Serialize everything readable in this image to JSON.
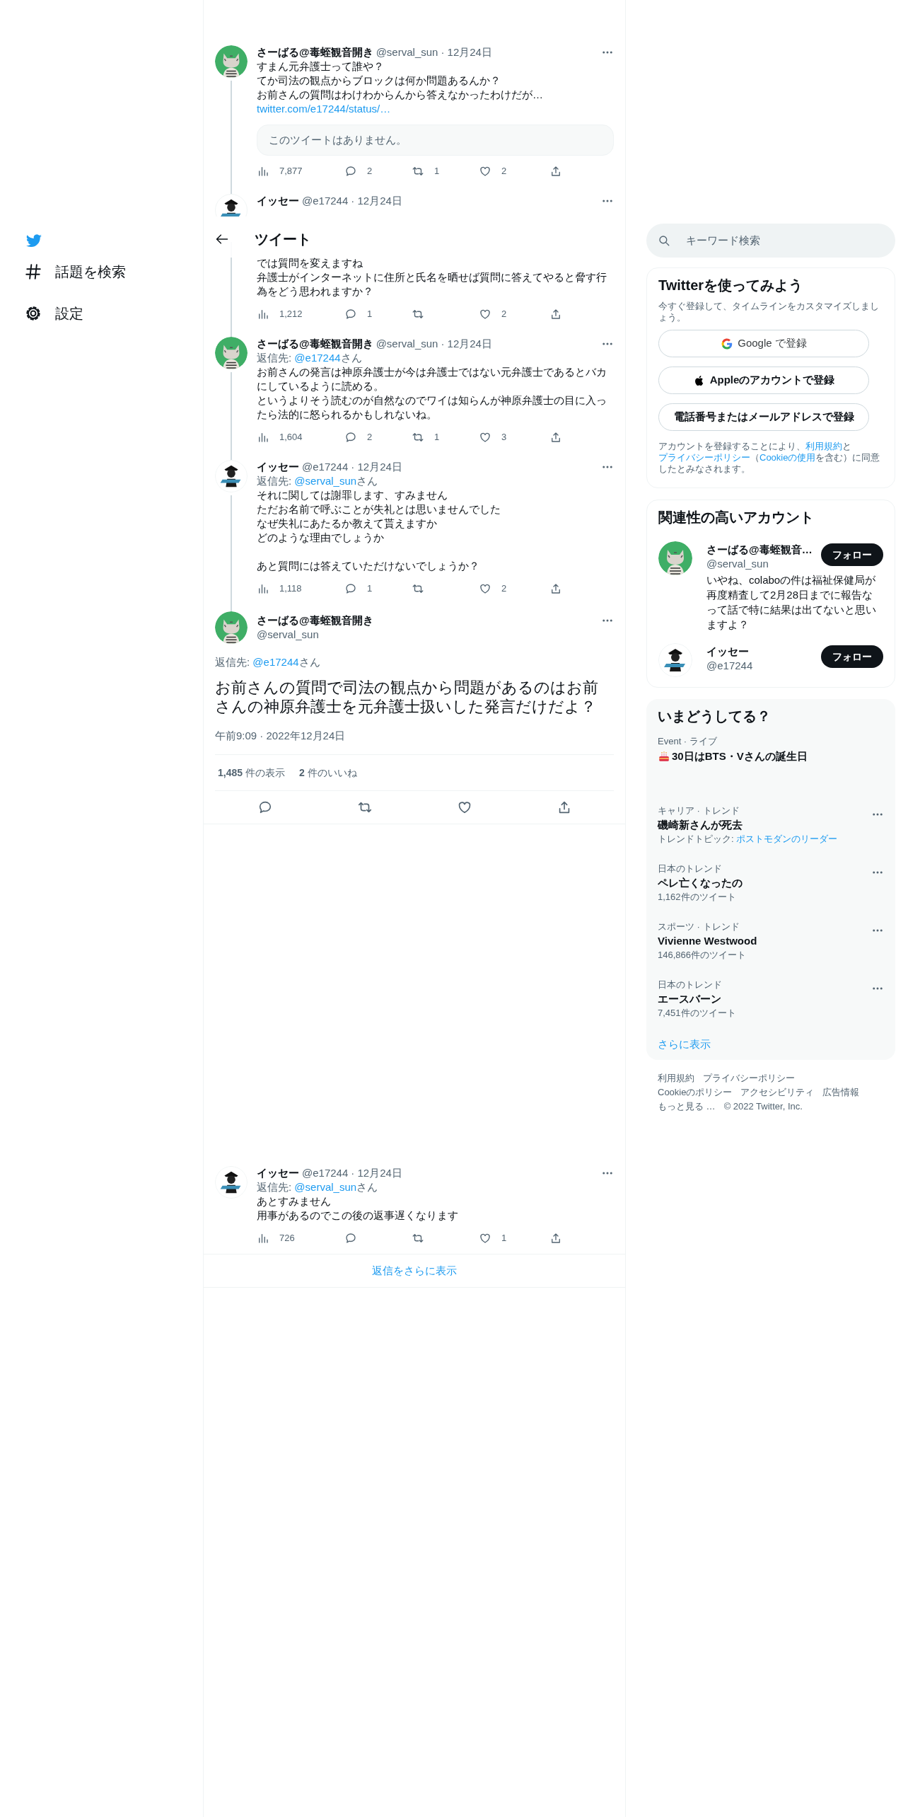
{
  "sidebar": {
    "items": [
      {
        "label": "話題を検索"
      },
      {
        "label": "設定"
      }
    ]
  },
  "header": {
    "title": "ツイート"
  },
  "thread": [
    {
      "name": "さーばる@毒蛭観音開き",
      "handle": "@serval_sun",
      "date": "· 12月24日",
      "paragraphs": [
        [
          "すまん元弁護士って誰や？",
          "てか司法の観点からブロックは何か問題あるんか？",
          "お前さんの質問はわけわからんから答えなかったわけだが…"
        ]
      ],
      "link": "twitter.com/e17244/status/…",
      "quote": "このツイートはありません。",
      "stats": {
        "views": "7,877",
        "replies": "2",
        "retweets": "1",
        "likes": "2"
      }
    },
    {
      "name": "イッセー",
      "handle": "@e17244",
      "date": "· 12月24日",
      "under_header": true,
      "paragraphs": [
        [
          "では質問を変えますね",
          "弁護士がインターネットに住所と氏名を晒せば質問に答えてやると脅す行為をどう思われますか？"
        ]
      ],
      "stats": {
        "views": "1,212",
        "replies": "1",
        "likes": "2"
      }
    },
    {
      "name": "さーばる@毒蛭観音開き",
      "handle": "@serval_sun",
      "date": "· 12月24日",
      "reply_to": {
        "prefix": "返信先: ",
        "handle": "@e17244",
        "suffix": "さん"
      },
      "paragraphs": [
        [
          "お前さんの発言は神原弁護士が今は弁護士ではない元弁護士であるとバカにしているように読める。",
          "というよりそう読むのが自然なのでワイは知らんが神原弁護士の目に入ったら法的に怒られるかもしれないね。"
        ]
      ],
      "stats": {
        "views": "1,604",
        "replies": "2",
        "retweets": "1",
        "likes": "3"
      }
    },
    {
      "name": "イッセー",
      "handle": "@e17244",
      "date": "· 12月24日",
      "reply_to": {
        "prefix": "返信先: ",
        "handle": "@serval_sun",
        "suffix": "さん"
      },
      "paragraphs": [
        [
          "それに関しては謝罪します、すみません",
          "ただお名前で呼ぶことが失礼とは思いませんでした",
          "なぜ失礼にあたるか教えて貰えますか",
          "どのような理由でしょうか"
        ],
        [
          "あと質問には答えていただけないでしょうか？"
        ]
      ],
      "stats": {
        "views": "1,118",
        "replies": "1",
        "likes": "2"
      }
    }
  ],
  "main_tweet": {
    "name": "さーばる@毒蛭観音開き",
    "handle": "@serval_sun",
    "reply_to": {
      "prefix": "返信先: ",
      "handle": "@e17244",
      "suffix": "さん"
    },
    "text": "お前さんの質問で司法の観点から問題があるのはお前さんの神原弁護士を元弁護士扱いした発言だけだよ？",
    "time": "午前9:09 · 2022年12月24日",
    "counts": [
      "**1,485** 件の表示",
      "**2** 件のいいね"
    ]
  },
  "replies": [
    {
      "name": "イッセー",
      "handle": "@e17244",
      "date": "· 12月24日",
      "reply_to": {
        "prefix": "返信先: ",
        "handle": "@serval_sun",
        "suffix": "さん"
      },
      "paragraphs": [
        [
          "あとすみません",
          "用事があるのでこの後の返事遅くなります"
        ]
      ],
      "stats": {
        "views": "726",
        "likes": "1"
      }
    }
  ],
  "show_more_replies": "返信をさらに表示",
  "search": {
    "placeholder": "キーワード検索"
  },
  "signup": {
    "title": "Twitterを使ってみよう",
    "subtitle": "今すぐ登録して、タイムラインをカスタマイズしましょう。",
    "buttons": [
      {
        "label": "Google で登録"
      },
      {
        "label": "Appleのアカウントで登録"
      },
      {
        "label": "電話番号またはメールアドレスで登録"
      }
    ],
    "legal": [
      {
        "text": "アカウントを登録することにより、",
        "link": false
      },
      {
        "text": "利用規約",
        "link": true
      },
      {
        "text": "と",
        "link": false
      },
      {
        "text": "プライバシーポリシー",
        "link": true
      },
      {
        "text": "（",
        "link": false
      },
      {
        "text": "Cookieの使用",
        "link": true
      },
      {
        "text": "を含む）に同意したとみなされます。",
        "link": false
      }
    ]
  },
  "accounts": {
    "title": "関連性の高いアカウント",
    "items": [
      {
        "name": "さーばる@毒蛭観音…",
        "handle": "@serval_sun",
        "bio": "いやね、colaboの件は福祉保健局が再度精査して2月28日までに報告なって話で特に結果は出てないと思いますよ？",
        "button": "フォロー"
      },
      {
        "name": "イッセー",
        "handle": "@e17244",
        "button": "フォロー"
      }
    ]
  },
  "trends": {
    "title": "いまどうしてる？",
    "items": [
      {
        "kind": "event",
        "category": "Event · ライブ",
        "title": "30日はBTS・Vさんの誕生日"
      },
      {
        "kind": "trend",
        "category": "キャリア · トレンド",
        "title": "磯崎新さんが死去",
        "topic_label": "トレンドトピック: ",
        "topic": "ポストモダンのリーダー"
      },
      {
        "kind": "trend",
        "category": "日本のトレンド",
        "title": "ペレ亡くなったの",
        "count": "1,162件のツイート"
      },
      {
        "kind": "trend",
        "category": "スポーツ · トレンド",
        "title": "Vivienne Westwood",
        "count": "146,866件のツイート"
      },
      {
        "kind": "trend",
        "category": "日本のトレンド",
        "title": "エースバーン",
        "count": "7,451件のツイート"
      }
    ],
    "more": "さらに表示"
  },
  "footer_rows": [
    [
      "利用規約",
      "プライバシーポリシー"
    ],
    [
      "Cookieのポリシー",
      "アクセシビリティ",
      "広告情報"
    ],
    [
      "もっと見る …",
      "© 2022 Twitter, Inc."
    ]
  ]
}
